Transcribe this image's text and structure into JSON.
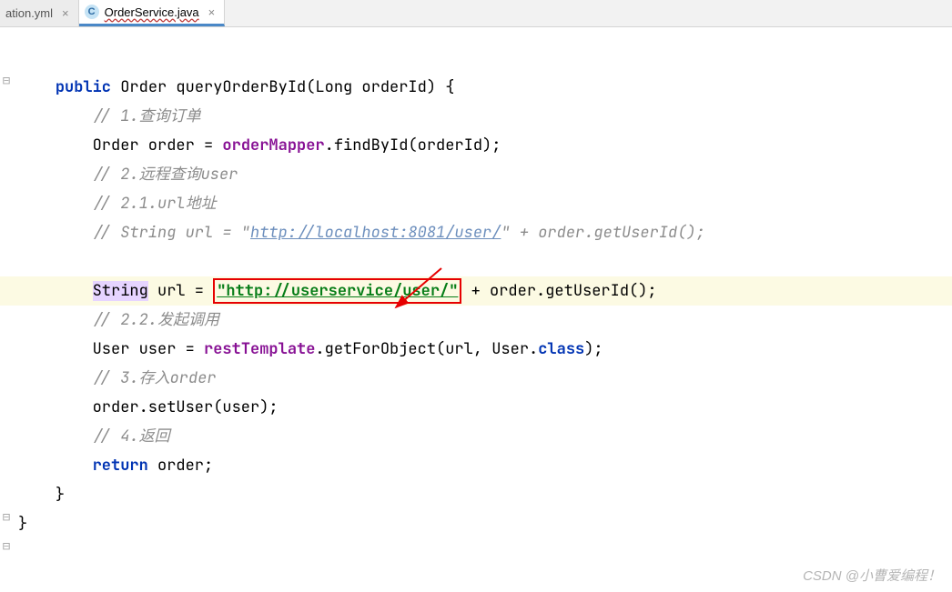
{
  "tabs": [
    {
      "label": "ation.yml",
      "icon": "",
      "active": false
    },
    {
      "label": "OrderService.java",
      "icon": "C",
      "active": true
    }
  ],
  "code": {
    "l1_public": "public",
    "l1_sig": " Order queryOrderById(Long orderId) {",
    "l2": "// 1.查询订单",
    "l3a": "Order order = ",
    "l3b": "orderMapper",
    "l3c": ".findById(orderId);",
    "l4": "// 2.远程查询user",
    "l5": "// 2.1.url地址",
    "l6a": "// String url = \"",
    "l6b": "http://localhost:8081/user/",
    "l6c": "\" + order.getUserId();",
    "l7a": "String",
    "l7b": " url = ",
    "l7c": "\"http://userservice/user/\"",
    "l7d": " + order.getUserId();",
    "l8": "// 2.2.发起调用",
    "l9a": "User user = ",
    "l9b": "restTemplate",
    "l9c": ".getForObject(url, User.",
    "l9d": "class",
    "l9e": ");",
    "l10": "// 3.存入order",
    "l11": "order.setUser(user);",
    "l12": "// 4.返回",
    "l13a": "return",
    "l13b": " order;",
    "l14": "}",
    "l15": "}"
  },
  "watermark": "CSDN @小曹爱编程！"
}
